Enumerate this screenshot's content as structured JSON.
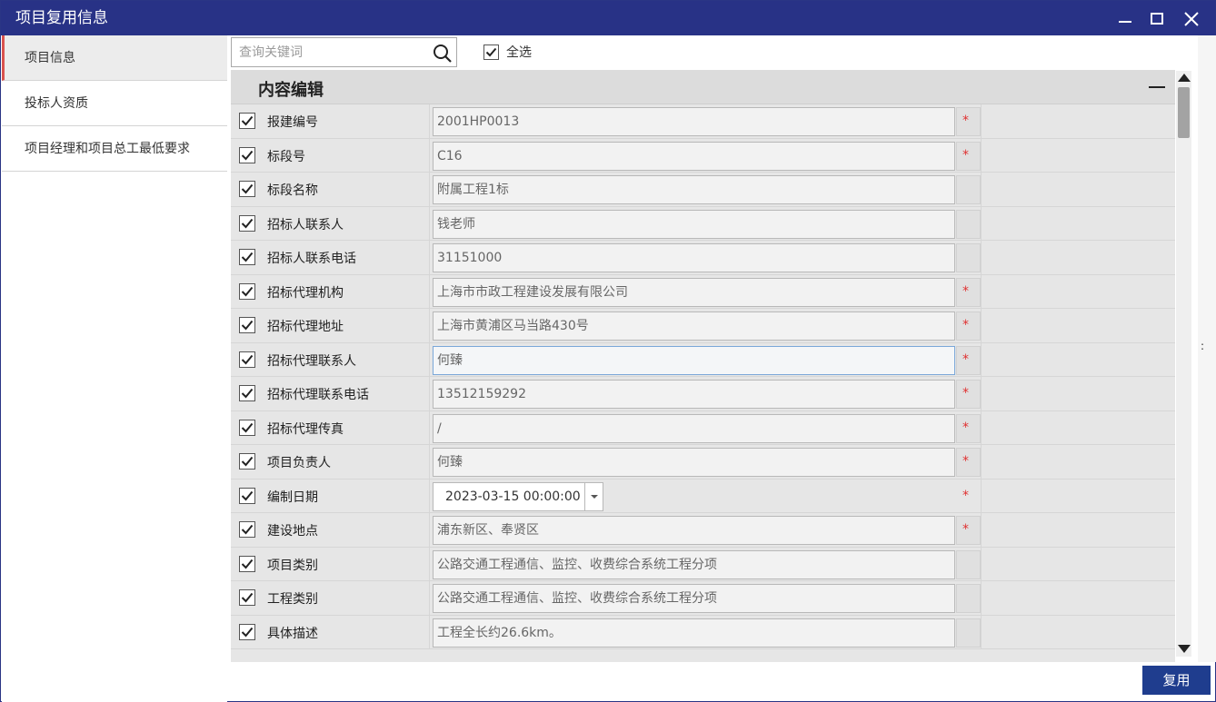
{
  "window": {
    "title": "项目复用信息"
  },
  "sidebar": {
    "items": [
      {
        "label": "项目信息",
        "active": true
      },
      {
        "label": "投标人资质",
        "active": false
      },
      {
        "label": "项目经理和项目总工最低要求",
        "active": false
      }
    ]
  },
  "toolbar": {
    "search_placeholder": "查询关键词",
    "select_all_label": "全选",
    "select_all_checked": true
  },
  "section": {
    "title": "内容编辑"
  },
  "fields": [
    {
      "label": "报建编号",
      "value": "2001HP0013",
      "required": true,
      "checked": true
    },
    {
      "label": "标段号",
      "value": "C16",
      "required": true,
      "checked": true
    },
    {
      "label": "标段名称",
      "value": "附属工程1标",
      "required": false,
      "checked": true
    },
    {
      "label": "招标人联系人",
      "value": "钱老师",
      "required": false,
      "checked": true
    },
    {
      "label": "招标人联系电话",
      "value": "31151000",
      "required": false,
      "checked": true
    },
    {
      "label": "招标代理机构",
      "value": "上海市市政工程建设发展有限公司",
      "required": true,
      "checked": true
    },
    {
      "label": "招标代理地址",
      "value": "上海市黄浦区马当路430号",
      "required": true,
      "checked": true
    },
    {
      "label": "招标代理联系人",
      "value": "何臻",
      "required": true,
      "checked": true,
      "focused": true
    },
    {
      "label": "招标代理联系电话",
      "value": "13512159292",
      "required": true,
      "checked": true
    },
    {
      "label": "招标代理传真",
      "value": "/",
      "required": true,
      "checked": true
    },
    {
      "label": "项目负责人",
      "value": "何臻",
      "required": true,
      "checked": true
    },
    {
      "label": "编制日期",
      "value": "2023-03-15 00:00:00",
      "required": true,
      "checked": true,
      "type": "date"
    },
    {
      "label": "建设地点",
      "value": "浦东新区、奉贤区",
      "required": true,
      "checked": true
    },
    {
      "label": "项目类别",
      "value": "公路交通工程通信、监控、收费综合系统工程分项",
      "required": false,
      "checked": true
    },
    {
      "label": "工程类别",
      "value": "公路交通工程通信、监控、收费综合系统工程分项",
      "required": false,
      "checked": true
    },
    {
      "label": "具体描述",
      "value": "工程全长约26.6km。",
      "required": false,
      "checked": true
    }
  ],
  "required_mark": "*",
  "actions": {
    "reuse_label": "复用"
  },
  "right_strip": {
    "handle": ":"
  },
  "colors": {
    "titlebar": "#283286",
    "accent": "#1f3d8e",
    "required": "#e03030",
    "active_marker": "#d9534f"
  }
}
